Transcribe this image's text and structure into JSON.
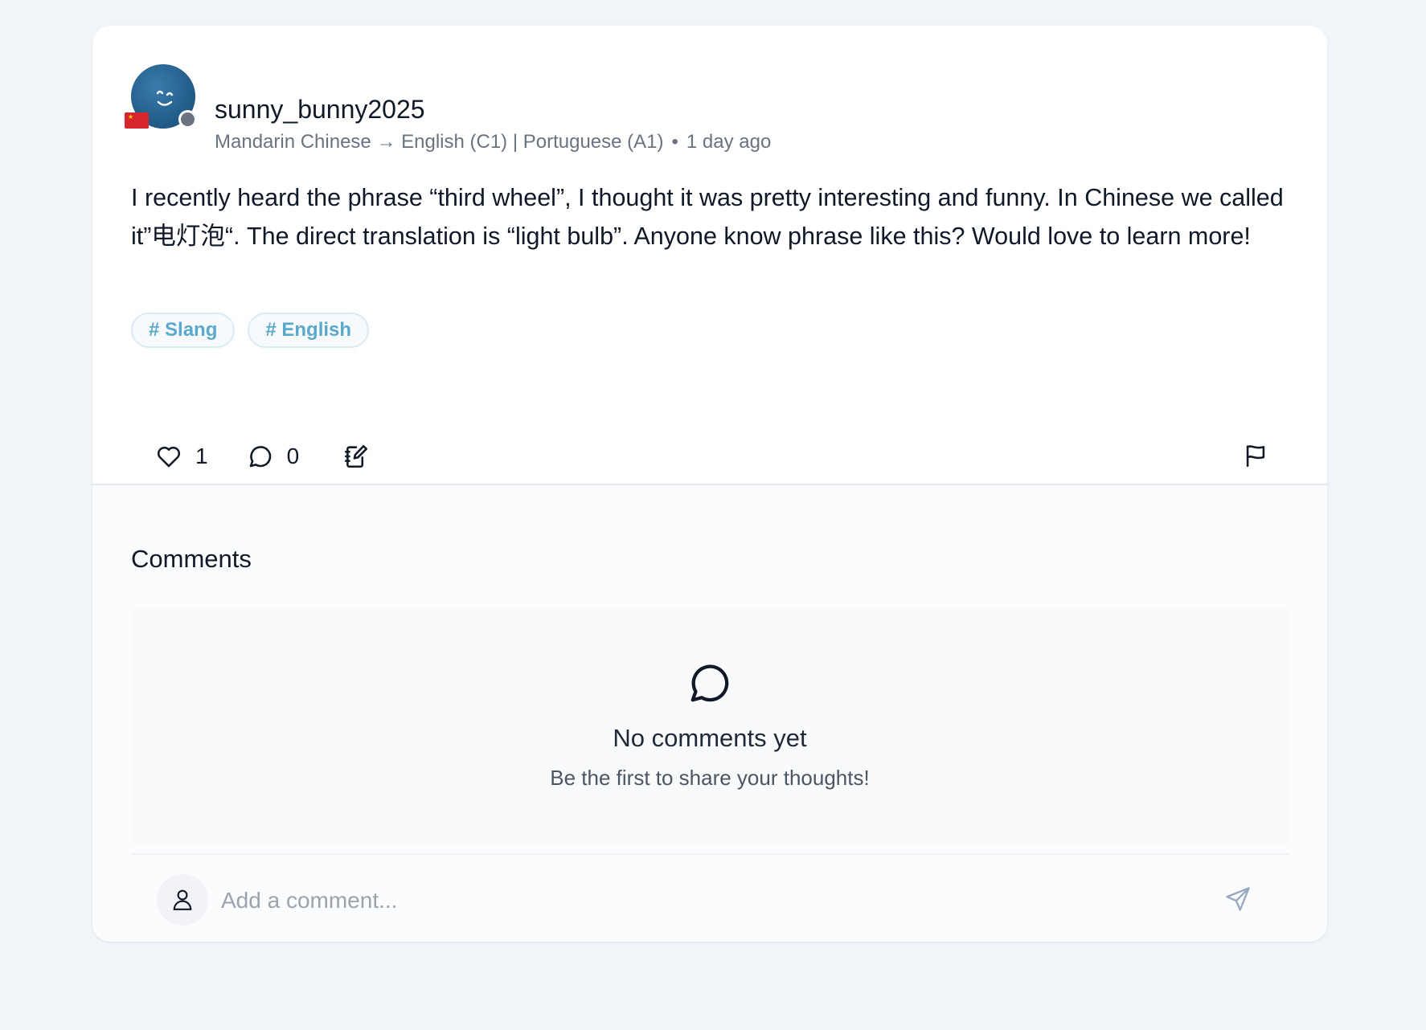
{
  "post": {
    "author": {
      "username": "sunny_bunny2025",
      "flag_icon": "china-flag-icon",
      "status_color": "#6b7280",
      "avatar_color": "#23618f"
    },
    "meta": {
      "languages": "Mandarin Chinese → English (C1) | Portuguese (A1)",
      "separator": "•",
      "time_ago": "1 day ago"
    },
    "text": "I recently heard the phrase “third wheel”, I thought it was pretty interesting and funny. In Chinese we called it”电灯泡“. The direct translation is “light bulb”. Anyone know phrase like this? Would love to learn more!",
    "tags": [
      "# Slang",
      "# English"
    ],
    "actions": {
      "like_count": "1",
      "comment_count": "0",
      "like_icon": "heart-icon",
      "comment_icon": "comment-bubble-icon",
      "notebook_icon": "notebook-edit-icon",
      "report_icon": "flag-icon"
    }
  },
  "comments": {
    "title": "Comments",
    "empty_title": "No comments yet",
    "empty_subtitle": "Be the first to share your thoughts!",
    "input_placeholder": "Add a comment...",
    "send_icon": "send-icon",
    "user_icon": "user-icon"
  },
  "colors": {
    "background": "#f1f5f9",
    "tag_text": "#5aa9cc",
    "muted_text": "#6b7280"
  }
}
